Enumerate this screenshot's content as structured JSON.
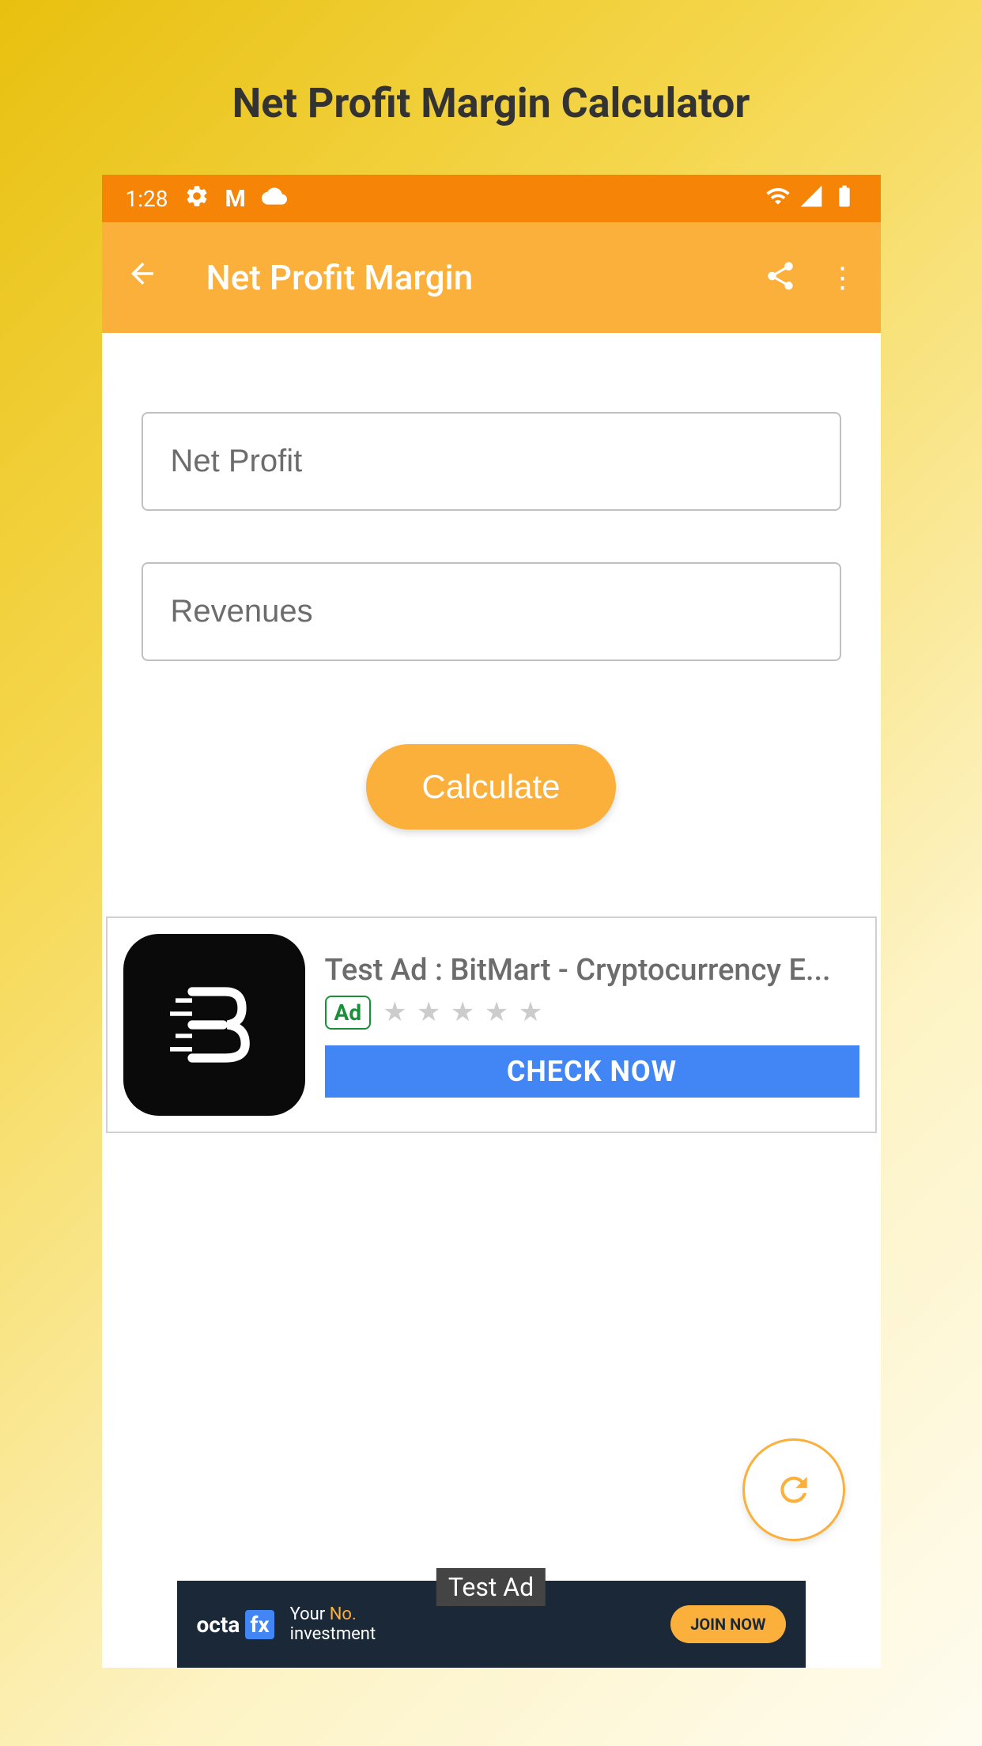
{
  "page": {
    "title": "Net Profit Margin Calculator"
  },
  "statusBar": {
    "time": "1:28"
  },
  "appBar": {
    "title": "Net Profit Margin"
  },
  "inputs": {
    "netProfit": {
      "placeholder": "Net Profit",
      "value": ""
    },
    "revenues": {
      "placeholder": "Revenues",
      "value": ""
    }
  },
  "buttons": {
    "calculate": "Calculate"
  },
  "ad1": {
    "title": "Test Ad :  BitMart - Cryptocurrency E...",
    "badge": "Ad",
    "cta": "CHECK NOW"
  },
  "ad2": {
    "logo": "octa",
    "logoBrand": "fx",
    "textPrefix": "Your ",
    "textHighlight": "No.",
    "textSuffix": " investment",
    "cta": "JOIN NOW",
    "overlay": "Test Ad"
  }
}
